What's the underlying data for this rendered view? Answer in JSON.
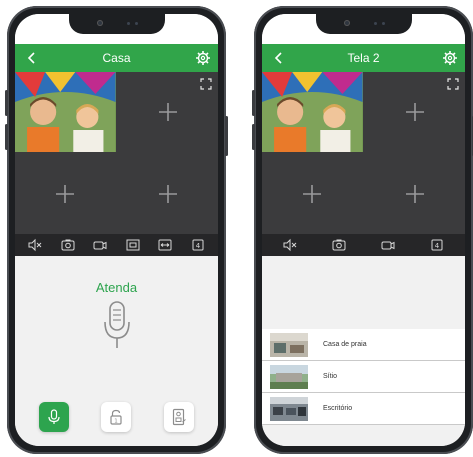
{
  "colors": {
    "brand_green": "#31a54a",
    "video_bg": "#3b3b3d",
    "toolbar_bg": "#262628"
  },
  "phone_left": {
    "header": {
      "title": "Casa",
      "back_icon": "chevron-left-icon",
      "settings_icon": "gear-icon"
    },
    "grid": {
      "cells": [
        "video",
        "add",
        "add",
        "add"
      ],
      "add_icon": "plus-icon"
    },
    "toolbar": {
      "icons": [
        "mute-icon",
        "snapshot-icon",
        "record-icon",
        "window-fit-icon",
        "stretch-icon",
        "grid-4-icon"
      ]
    },
    "intercom": {
      "label": "Atenda",
      "mic_icon": "microphone-icon",
      "buttons": [
        {
          "name": "talk-button",
          "icon": "microphone-icon",
          "active": true
        },
        {
          "name": "unlock-button",
          "icon": "padlock-icon",
          "badge": "1",
          "active": false
        },
        {
          "name": "intercom-device-button",
          "icon": "intercom-icon",
          "active": false
        }
      ]
    }
  },
  "phone_right": {
    "header": {
      "title": "Tela 2",
      "back_icon": "chevron-left-icon",
      "settings_icon": "gear-icon"
    },
    "grid": {
      "cells": [
        "video",
        "add",
        "add",
        "add"
      ]
    },
    "toolbar": {
      "icons": [
        "mute-icon",
        "snapshot-icon",
        "record-icon",
        "grid-4-icon"
      ]
    },
    "devices": [
      {
        "label": "Casa de praia"
      },
      {
        "label": "Sítio"
      },
      {
        "label": "Escritório"
      }
    ]
  }
}
